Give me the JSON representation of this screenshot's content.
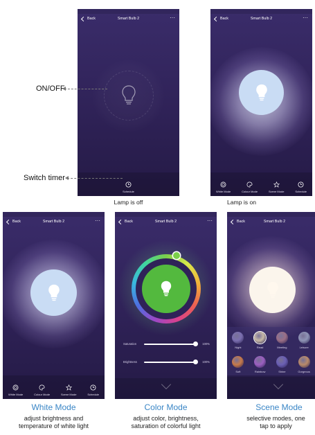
{
  "nav": {
    "back_label": "Back",
    "title": "Smart Bulb 2",
    "more_label": "···"
  },
  "annotations": {
    "on_off": "ON/OFF",
    "switch_timer": "Switch timer"
  },
  "captions": {
    "lamp_off": "Lamp is off",
    "lamp_on": "Lamp is on"
  },
  "tabs": [
    "White Mode",
    "Colour Mode",
    "Scene Mode",
    "Schedule"
  ],
  "schedule_label": "Schedule",
  "color_screen": {
    "sliders": [
      {
        "label": "Saturation",
        "value": "100%",
        "level": 1.0
      },
      {
        "label": "Brightness",
        "value": "100%",
        "level": 1.0
      }
    ]
  },
  "scenes": [
    {
      "name": "Night",
      "color": "#7b6fb0",
      "active": false
    },
    {
      "name": "Read",
      "color": "#c7b9a6",
      "active": true
    },
    {
      "name": "Meeting",
      "color": "#9a6f86",
      "active": false
    },
    {
      "name": "Leisure",
      "color": "#8f94b6",
      "active": false
    },
    {
      "name": "Soft",
      "color": "#c67a4a",
      "active": false
    },
    {
      "name": "Rainbow",
      "color": "#9b5fc0",
      "active": false
    },
    {
      "name": "Shine",
      "color": "#6a5fb4",
      "active": false
    },
    {
      "name": "Gorgeous",
      "color": "#b98a6a",
      "active": false
    }
  ],
  "modes": {
    "white": {
      "title": "White Mode",
      "desc1": "adjust brightness and",
      "desc2": "temperature of white light"
    },
    "color": {
      "title": "Color Mode",
      "desc1": "adjust color, brightness,",
      "desc2": "saturation of colorful light"
    },
    "scene": {
      "title": "Scene Mode",
      "desc1": "selective modes, one",
      "desc2": "tap to apply"
    }
  },
  "colors": {
    "accent_blue": "#3a86c6",
    "bulb_white": "#c9dcf4",
    "bulb_green": "#53b93e",
    "scene_white": "#fbf5ec"
  }
}
